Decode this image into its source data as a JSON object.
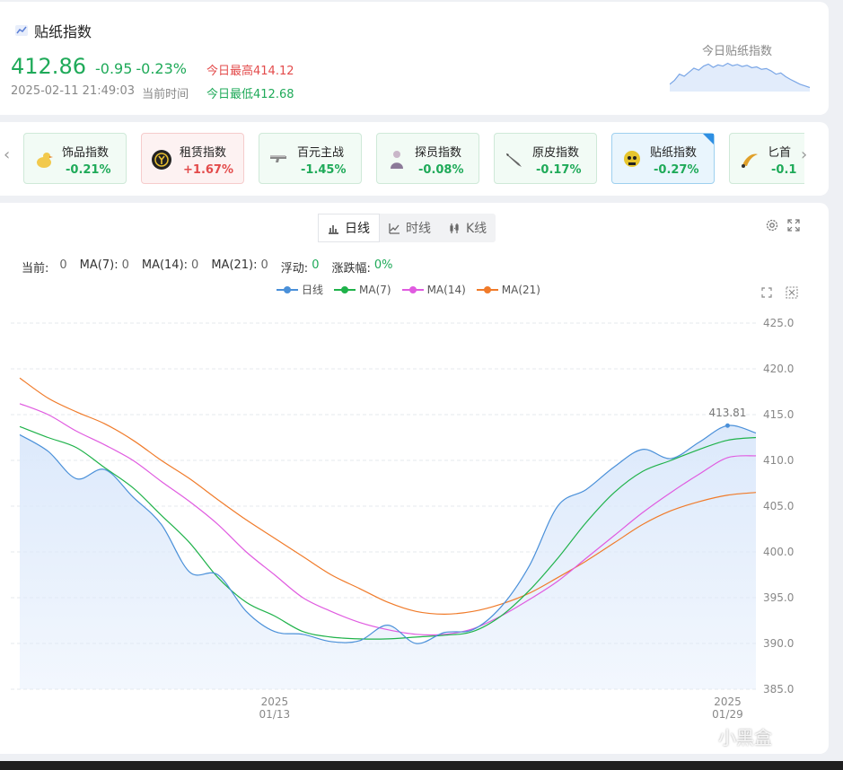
{
  "header": {
    "title": "贴纸指数",
    "price": "412.86",
    "change": "-0.95",
    "change_pct": "-0.23%",
    "timestamp": "2025-02-11 21:49:03",
    "timestamp_label": "当前时间",
    "day_high": "今日最高414.12",
    "day_low": "今日最低412.68",
    "sparkline_label": "今日贴纸指数",
    "sparkline_values": [
      395,
      396,
      397.5,
      397,
      398,
      399,
      398.5,
      399.5,
      400,
      399.2,
      399.8,
      399.5,
      400.2,
      399.6,
      399.9,
      399.4,
      399.7,
      399.1,
      399.3,
      398.7,
      398.9,
      398.3,
      397.5,
      397.8,
      396.9,
      396.2,
      395.6,
      395.0,
      394.6,
      394.2
    ]
  },
  "index_tiles": [
    {
      "name": "饰品指数",
      "pct": "-0.21%",
      "icon": "duck-icon",
      "trend": "down"
    },
    {
      "name": "租赁指数",
      "pct": "+1.67%",
      "icon": "rental-coin-icon",
      "trend": "up"
    },
    {
      "name": "百元主战",
      "pct": "-1.45%",
      "icon": "pistol-icon",
      "trend": "down"
    },
    {
      "name": "探员指数",
      "pct": "-0.08%",
      "icon": "agent-icon",
      "trend": "down"
    },
    {
      "name": "原皮指数",
      "pct": "-0.17%",
      "icon": "knife-icon",
      "trend": "down"
    },
    {
      "name": "贴纸指数",
      "pct": "-0.27%",
      "icon": "sticker-skull-icon",
      "trend": "down",
      "selected": true
    },
    {
      "name": "匕首",
      "pct": "-0.1",
      "icon": "karambit-icon",
      "trend": "down"
    }
  ],
  "tabs": [
    {
      "label": "日线",
      "icon": "bar-chart-icon",
      "active": true
    },
    {
      "label": "时线",
      "icon": "line-chart-icon",
      "active": false
    },
    {
      "label": "K线",
      "icon": "candlestick-icon",
      "active": false
    }
  ],
  "stats": {
    "current_label": "当前:",
    "current": "0",
    "ma7_label": "MA(7):",
    "ma7": "0",
    "ma14_label": "MA(14):",
    "ma14": "0",
    "ma21_label": "MA(21):",
    "ma21": "0",
    "float_label": "浮动:",
    "float": "0",
    "change_label": "涨跌幅:",
    "change": "0%"
  },
  "chart_data": {
    "type": "line",
    "ylim": [
      385,
      425
    ],
    "yticks": [
      "425.0",
      "420.0",
      "415.0",
      "410.0",
      "405.0",
      "400.0",
      "395.0",
      "390.0",
      "385.0"
    ],
    "xticks": [
      {
        "index": 9,
        "year": "2025",
        "date": "01/13"
      },
      {
        "index": 25,
        "year": "2025",
        "date": "01/29"
      }
    ],
    "last_label": "413.81",
    "colors": {
      "daily": "#4a90d9",
      "ma7": "#1fb24a",
      "ma14": "#e05be0",
      "ma21": "#f07b2a",
      "fill": "#dce9fb"
    },
    "series": [
      {
        "name": "日线",
        "values": [
          412.8,
          411,
          408,
          409,
          406,
          403,
          397.8,
          397.5,
          393.5,
          391.3,
          391,
          390.2,
          390.3,
          392,
          390,
          391.2,
          391.5,
          394,
          398.5,
          405,
          406.8,
          409.3,
          411.2,
          410.2,
          412,
          413.8,
          413
        ]
      },
      {
        "name": "MA(7)",
        "values": [
          413.7,
          412.5,
          411.4,
          409.2,
          407,
          404,
          401,
          397.2,
          394.5,
          393,
          391.3,
          390.7,
          390.5,
          390.5,
          390.7,
          390.9,
          391.3,
          393,
          395.8,
          399.3,
          403.2,
          406.5,
          408.8,
          410,
          411.2,
          412.2,
          412.5
        ]
      },
      {
        "name": "MA(14)",
        "values": [
          416.2,
          415,
          413.2,
          411.7,
          410,
          407.7,
          405.5,
          403,
          400,
          397.5,
          395,
          393.5,
          392.3,
          391.5,
          391,
          391,
          391.6,
          393,
          394.8,
          396.8,
          399.3,
          401.8,
          404.3,
          406.5,
          408.5,
          410.3,
          410.5
        ]
      },
      {
        "name": "MA(21)",
        "values": [
          419,
          416.8,
          415.3,
          414,
          412.2,
          410,
          408,
          405.7,
          403.5,
          401.5,
          399.5,
          397.5,
          396,
          394.5,
          393.5,
          393.2,
          393.5,
          394.3,
          395.5,
          397.2,
          399,
          401,
          403,
          404.5,
          405.5,
          406.2,
          406.5
        ]
      }
    ]
  },
  "watermark": "小黑盒"
}
